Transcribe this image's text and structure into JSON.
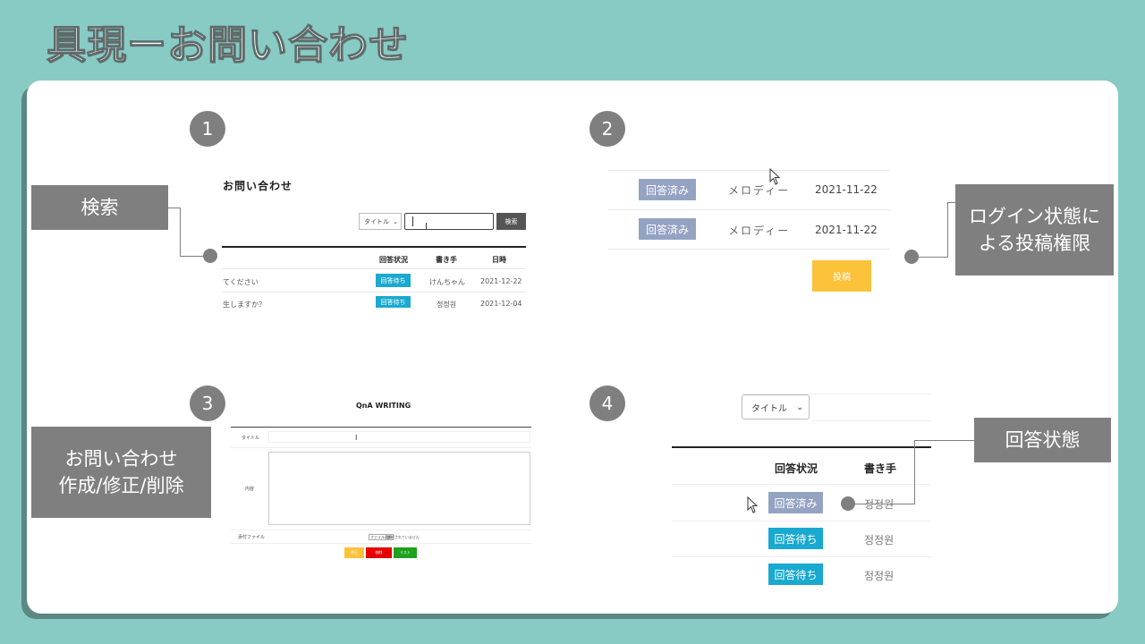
{
  "slide": {
    "title": "具現ーお問い合わせ"
  },
  "numbers": [
    "1",
    "2",
    "3",
    "4"
  ],
  "labels": {
    "search": "検索",
    "login_line1": "ログイン状態に",
    "login_line2": "よる投稿権限",
    "crud_line1": "お問い合わせ",
    "crud_line2": "作成/修正/削除",
    "answer_status": "回答状態"
  },
  "panel1": {
    "page_title": "お問い合わせ",
    "select_value": "タイトル",
    "search_button": "検索",
    "headers": [
      "回答状況",
      "書き手",
      "日時"
    ],
    "rows": [
      {
        "title": "てください",
        "status": "回答待ち",
        "writer": "けんちゃん",
        "date": "2021-12-22"
      },
      {
        "title": "生しますか？",
        "status": "回答待ち",
        "writer": "정정원",
        "date": "2021-12-04"
      }
    ]
  },
  "panel2": {
    "rows": [
      {
        "status": "回答済み",
        "writer": "メロディー",
        "date": "2021-11-22"
      },
      {
        "status": "回答済み",
        "writer": "メロディー",
        "date": "2021-11-22"
      }
    ],
    "post_button": "投稿"
  },
  "panel3": {
    "form_title": "QnA WRITING",
    "field_title": "タイトル",
    "field_content": "内容",
    "field_file": "添付ファイル",
    "file_button": "ファイル選択",
    "file_status": "選択されていません",
    "buttons": [
      "修正",
      "削除",
      "リスト"
    ]
  },
  "panel4": {
    "select_value": "タイトル",
    "headers": [
      "回答状況",
      "書き手"
    ],
    "rows": [
      {
        "status": "回答済み",
        "writer": "정정원"
      },
      {
        "status": "回答待ち",
        "writer": "정정원"
      },
      {
        "status": "回答待ち",
        "writer": "정정원"
      }
    ]
  },
  "colors": {
    "background": "#87cbc4",
    "wait_badge": "#1aa9cf",
    "done_badge": "#95a3c3",
    "post_button": "#fcc23a",
    "label_box": "#7f7f7f"
  }
}
